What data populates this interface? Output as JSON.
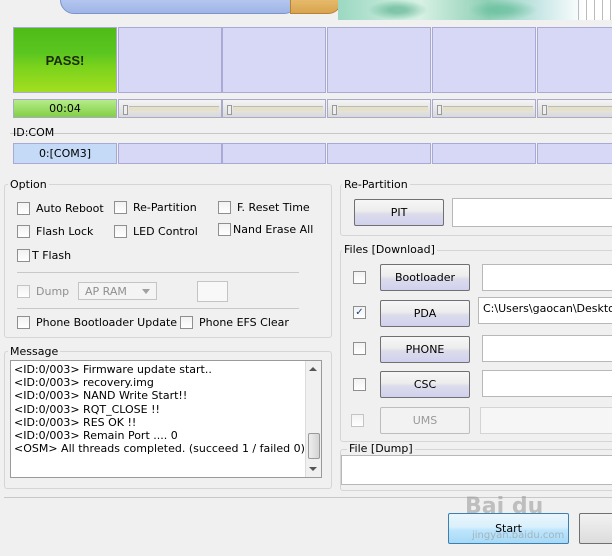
{
  "ports": {
    "pass_label": "PASS!",
    "timer": "00:04",
    "id_com_label": "ID:COM",
    "com_port": "0:[COM3]"
  },
  "option": {
    "title": "Option",
    "auto_reboot": "Auto Reboot",
    "re_partition": "Re-Partition",
    "f_reset_time": "F. Reset Time",
    "flash_lock": "Flash Lock",
    "led_control": "LED Control",
    "nand_erase_all": "Nand Erase All",
    "t_flash": "T Flash",
    "dump": "Dump",
    "dump_select": "AP RAM",
    "phone_bootloader_update": "Phone Bootloader Update",
    "phone_efs_clear": "Phone EFS Clear"
  },
  "repartition": {
    "title": "Re-Partition",
    "pit_button": "PIT"
  },
  "files": {
    "title": "Files [Download]",
    "bootloader": "Bootloader",
    "pda": "PDA",
    "pda_path": "C:\\Users\\gaocan\\Desktop\\",
    "phone": "PHONE",
    "csc": "CSC",
    "ums": "UMS"
  },
  "dump_group": {
    "title": "File [Dump]"
  },
  "message": {
    "title": "Message",
    "lines": [
      "<ID:0/003> Firmware update start..",
      "<ID:0/003> recovery.img",
      "<ID:0/003> NAND Write Start!!",
      "<ID:0/003> RQT_CLOSE !!",
      "<ID:0/003> RES OK !!",
      "<ID:0/003> Remain Port ....  0",
      "<OSM> All threads completed. (succeed 1 / failed 0)"
    ]
  },
  "actions": {
    "start": "Start"
  },
  "watermark": {
    "text": "Bai du",
    "url": "jingyan.baidu.com"
  },
  "colors": {
    "pass_green": "#5cc620",
    "port_cell": "#d7d7f6",
    "start_button": "#bee6fd"
  },
  "icons": {
    "checkbox_checked": "check-mark",
    "scroll_up": "triangle-up",
    "scroll_down": "triangle-down",
    "dropdown": "chevron-down"
  }
}
